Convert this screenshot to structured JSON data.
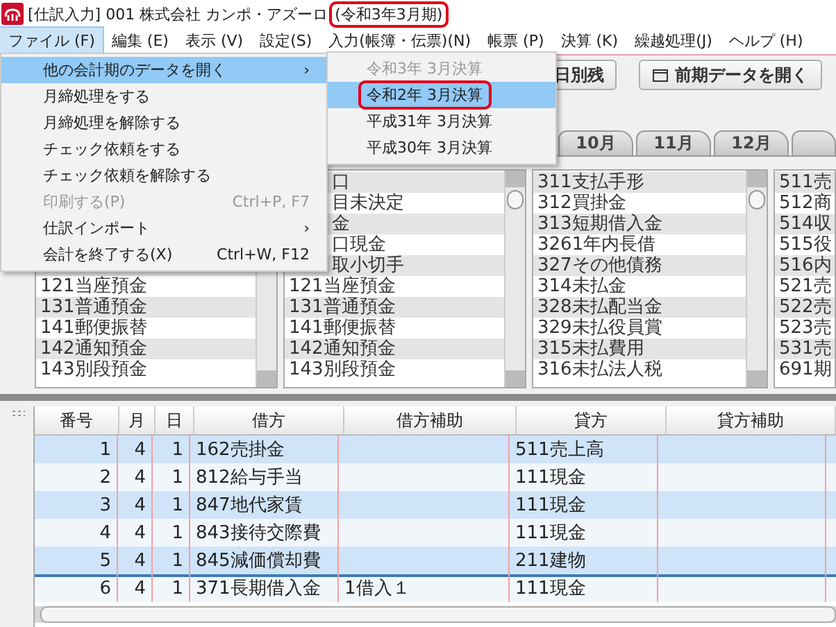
{
  "window": {
    "title": "[仕訳入力] 001 株式会社 カンポ・アズーロ",
    "period": "(令和3年3月期)",
    "period_outlined": true
  },
  "menu_bar": [
    {
      "label": "ファイル (F)",
      "selected": true
    },
    {
      "label": "編集 (E)",
      "selected": false
    },
    {
      "label": "表示 (V)",
      "selected": false
    },
    {
      "label": "設定(S)",
      "selected": false
    },
    {
      "label": "入力(帳簿・伝票)(N)",
      "selected": false
    },
    {
      "label": "帳票 (P)",
      "selected": false
    },
    {
      "label": "決算 (K)",
      "selected": false
    },
    {
      "label": "繰越処理(J)",
      "selected": false
    },
    {
      "label": "ヘルプ (H)",
      "selected": false
    }
  ],
  "file_menu": [
    {
      "label": "他の会計期のデータを開く",
      "shortcut": "›",
      "selected": true,
      "disabled": false
    },
    {
      "label": "月締処理をする",
      "selected": false,
      "disabled": false
    },
    {
      "label": "月締処理を解除する",
      "selected": false,
      "disabled": false
    },
    {
      "label": "チェック依頼をする",
      "selected": false,
      "disabled": false
    },
    {
      "label": "チェック依頼を解除する",
      "selected": false,
      "disabled": false
    },
    {
      "label": "印刷する(P)",
      "shortcut": "Ctrl+P, F7",
      "selected": false,
      "disabled": true
    },
    {
      "label": "仕訳インポート",
      "shortcut": "›",
      "selected": false,
      "disabled": false
    },
    {
      "label": "会計を終了する(X)",
      "shortcut": "Ctrl+W, F12",
      "selected": false,
      "disabled": false
    }
  ],
  "submenu": [
    {
      "label": "令和3年 3月決算",
      "selected": false,
      "disabled": true,
      "outlined": false
    },
    {
      "label": "令和2年 3月決算",
      "selected": true,
      "disabled": false,
      "outlined": true
    },
    {
      "label": "平成31年 3月決算",
      "selected": false,
      "disabled": false,
      "outlined": false
    },
    {
      "label": "平成30年 3月決算",
      "selected": false,
      "disabled": false,
      "outlined": false
    }
  ],
  "toolbar": {
    "buttons": [
      {
        "label": "日別残",
        "kind": "plain"
      },
      {
        "label": "前期データを開く",
        "kind": "icon"
      }
    ]
  },
  "month_tabs": [
    {
      "label": "10月",
      "selected": false
    },
    {
      "label": "11月",
      "selected": false
    },
    {
      "label": "12月",
      "selected": false
    }
  ],
  "account_lists": [
    [
      "121当座預金",
      "131普通預金",
      "141郵便振替",
      "142通知預金",
      "143別段預金"
    ],
    [
      "口",
      "目未決定",
      "金",
      "口現金",
      "取小切手",
      "121当座預金",
      "131普通預金",
      "141郵便振替",
      "142通知預金",
      "143別段預金"
    ],
    [
      "311支払手形",
      "312買掛金",
      "313短期借入金",
      "3261年内長借",
      "327その他債務",
      "314未払金",
      "328未払配当金",
      "329未払役員賞",
      "315未払費用",
      "316未払法人税"
    ],
    [
      "511売",
      "512商",
      "514収",
      "515役",
      "516内",
      "521売",
      "522売",
      "523売",
      "531売",
      "691期"
    ]
  ],
  "table": {
    "columns": [
      "番号",
      "月",
      "日",
      "借方",
      "借方補助",
      "貸方",
      "貸方補助"
    ],
    "rows": [
      {
        "cells": [
          "1",
          "4",
          "1",
          "162売掛金",
          "",
          "511売上高",
          ""
        ],
        "selected": false
      },
      {
        "cells": [
          "2",
          "4",
          "1",
          "812給与手当",
          "",
          "111現金",
          ""
        ],
        "selected": false
      },
      {
        "cells": [
          "3",
          "4",
          "1",
          "847地代家賃",
          "",
          "111現金",
          ""
        ],
        "selected": false
      },
      {
        "cells": [
          "4",
          "4",
          "1",
          "843接待交際費",
          "",
          "111現金",
          ""
        ],
        "selected": false
      },
      {
        "cells": [
          "5",
          "4",
          "1",
          "845減価償却費",
          "",
          "211建物",
          ""
        ],
        "selected": false
      },
      {
        "cells": [
          "6",
          "4",
          "1",
          "371長期借入金",
          "1借入１",
          "111現金",
          ""
        ],
        "selected": true
      }
    ]
  }
}
